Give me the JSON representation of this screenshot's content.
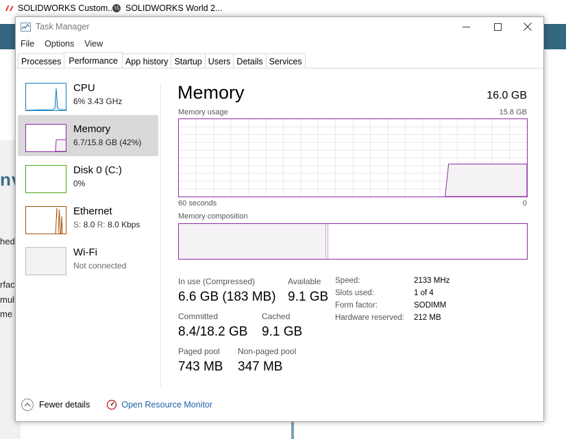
{
  "background": {
    "tabs": [
      {
        "label": "SOLIDWORKS Custom...",
        "icon": "solidworks-icon"
      },
      {
        "label": "SOLIDWORKS World 2...",
        "icon": "globe-icon"
      }
    ],
    "heading_fragment": "nv",
    "text_fragments": [
      "hed",
      "rfac",
      "muli",
      "me"
    ],
    "banner_color": "#33667f"
  },
  "window": {
    "title": "Task Manager",
    "icon": "task-manager-icon",
    "controls": [
      "minimize-icon",
      "maximize-icon",
      "close-icon"
    ]
  },
  "menu": [
    "File",
    "Options",
    "View"
  ],
  "tabs": [
    {
      "label": "Processes",
      "active": false
    },
    {
      "label": "Performance",
      "active": true
    },
    {
      "label": "App history",
      "active": false
    },
    {
      "label": "Startup",
      "active": false
    },
    {
      "label": "Users",
      "active": false
    },
    {
      "label": "Details",
      "active": false
    },
    {
      "label": "Services",
      "active": false
    }
  ],
  "sidebar": [
    {
      "name": "CPU",
      "sub": "6% 3.43 GHz",
      "color": "#117dbb",
      "selected": false
    },
    {
      "name": "Memory",
      "sub": "6.7/15.8 GB (42%)",
      "color": "#8b2aa1",
      "selected": true
    },
    {
      "name": "Disk 0 (C:)",
      "sub": "0%",
      "color": "#4da60c",
      "selected": false
    },
    {
      "name": "Ethernet",
      "sub_send_label": "S:",
      "sub_send": "8.0",
      "sub_recv_label": "R:",
      "sub_recv": "8.0 Kbps",
      "color": "#a74f01",
      "selected": false
    },
    {
      "name": "Wi-Fi",
      "sub": "Not connected",
      "color": "#bcbcbc",
      "selected": false
    }
  ],
  "main": {
    "title": "Memory",
    "total": "16.0 GB",
    "usage_label": "Memory usage",
    "usage_max": "15.8 GB",
    "time_left": "60 seconds",
    "time_right": "0",
    "composition_label": "Memory composition",
    "in_use_fraction": 0.42,
    "stats": {
      "in_use_label": "In use (Compressed)",
      "in_use_value": "6.6 GB (183 MB)",
      "available_label": "Available",
      "available_value": "9.1 GB",
      "committed_label": "Committed",
      "committed_value": "8.4/18.2 GB",
      "cached_label": "Cached",
      "cached_value": "9.1 GB",
      "paged_label": "Paged pool",
      "paged_value": "743 MB",
      "nonpaged_label": "Non-paged pool",
      "nonpaged_value": "347 MB"
    },
    "details": [
      {
        "label": "Speed:",
        "value": "2133 MHz"
      },
      {
        "label": "Slots used:",
        "value": "1 of 4"
      },
      {
        "label": "Form factor:",
        "value": "SODIMM"
      },
      {
        "label": "Hardware reserved:",
        "value": "212 MB"
      }
    ]
  },
  "footer": {
    "fewer_details": "Fewer details",
    "resource_monitor": "Open Resource Monitor"
  },
  "colors": {
    "memory_accent": "#8b2aa1",
    "link": "#1e64a8"
  }
}
